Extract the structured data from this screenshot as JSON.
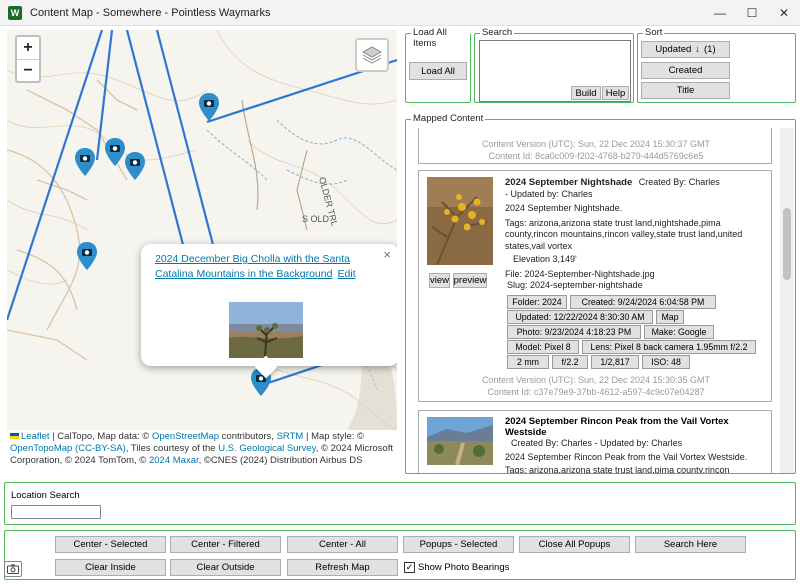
{
  "window": {
    "title": "Content Map - Somewhere - Pointless Waymarks",
    "icon_letter": "W",
    "minimize_icon": "—",
    "maximize_icon": "☐",
    "close_icon": "✕"
  },
  "map": {
    "zoom_in": "+",
    "zoom_out": "−",
    "road_labels": [
      "S OLD",
      "OLDER TRL"
    ],
    "popup": {
      "title": "2024 December Big Cholla with the Santa Catalina Mountains in the Background",
      "edit_label": "Edit",
      "close": "×"
    },
    "attribution": {
      "leaflet": "Leaflet",
      "t1": " | CalTopo, Map data: © ",
      "osm": "OpenStreetMap",
      "t2": " contributors, ",
      "srtm": "SRTM",
      "t3": " | Map style: © ",
      "opentopo": "OpenTopoMap",
      "t4": " ",
      "ccbysa": "(CC-BY-SA)",
      "t5": ", Tiles courtesy of the ",
      "usgs": "U.S. Geological Survey",
      "t6": ", © 2024 Microsoft Corporation, © 2024 TomTom, © ",
      "maxar": "2024 Maxar",
      "t7": ", ©CNES (2024) Distribution Airbus DS"
    }
  },
  "load_all": {
    "group_label": "Load All Items",
    "button": "Load All"
  },
  "search": {
    "group_label": "Search",
    "build": "Build",
    "help": "Help"
  },
  "sort": {
    "group_label": "Sort",
    "updated": "Updated",
    "updated_count": "(1)",
    "created": "Created",
    "title": "Title"
  },
  "mapped": {
    "group_label": "Mapped Content",
    "top_card": {
      "content_version": "Content Version (UTC): Sun, 22 Dec 2024 15:30:37 GMT",
      "content_id": "Content Id: 8ca0c009-f202-4768-b279-444d5769c6e5"
    },
    "card1": {
      "title": "2024 September Nightshade",
      "created_by": "Created By: Charles",
      "updated_by": "- Updated by: Charles",
      "summary": "2024 September Nightshade.",
      "tags": "Tags: arizona,arizona state trust land,nightshade,pima county,rincon mountains,rincon valley,state trust land,united states,vail vortex",
      "elevation": "Elevation 3,149'",
      "file": "File: 2024-September-Nightshade.jpg",
      "slug": "Slug: 2024-september-nightshade",
      "view": "view",
      "preview": "preview",
      "buttons": {
        "folder": "Folder: 2024",
        "created": "Created: 9/24/2024 6:04:58 PM",
        "updated": "Updated: 12/22/2024 8:30:30 AM",
        "map": "Map",
        "photo": "Photo: 9/23/2024 4:18:23 PM",
        "make": "Make: Google",
        "model": "Model: Pixel 8",
        "lens": "Lens: Pixel 8 back camera 1.95mm f/2.2",
        "focal": "2 mm",
        "aperture": "f/2.2",
        "shutter": "1/2,817",
        "iso": "ISO: 48"
      },
      "content_version": "Content Version (UTC): Sun, 22 Dec 2024 15:30:35 GMT",
      "content_id": "Content Id: c37e79e9-37bb-4612-a597-4c9c07e04287"
    },
    "card2": {
      "title": "2024 September Rincon Peak from the Vail Vortex Westside",
      "created_by": "Created By: Charles - Updated by: Charles",
      "summary": "2024 September Rincon Peak from the Vail Vortex Westside.",
      "tags": "Tags: arizona,arizona state trust land,pima county,rincon mountains,rincon valley,state trust land,united"
    }
  },
  "location_search": {
    "label": "Location Search"
  },
  "bottom": {
    "center_selected": "Center - Selected",
    "center_filtered": "Center - Filtered",
    "center_all": "Center - All",
    "popups_selected": "Popups - Selected",
    "close_all_popups": "Close All Popups",
    "search_here": "Search Here",
    "clear_inside": "Clear Inside",
    "clear_outside": "Clear Outside",
    "refresh_map": "Refresh Map",
    "show_photo_bearings": "Show Photo Bearings",
    "show_photo_bearings_checked": true
  }
}
